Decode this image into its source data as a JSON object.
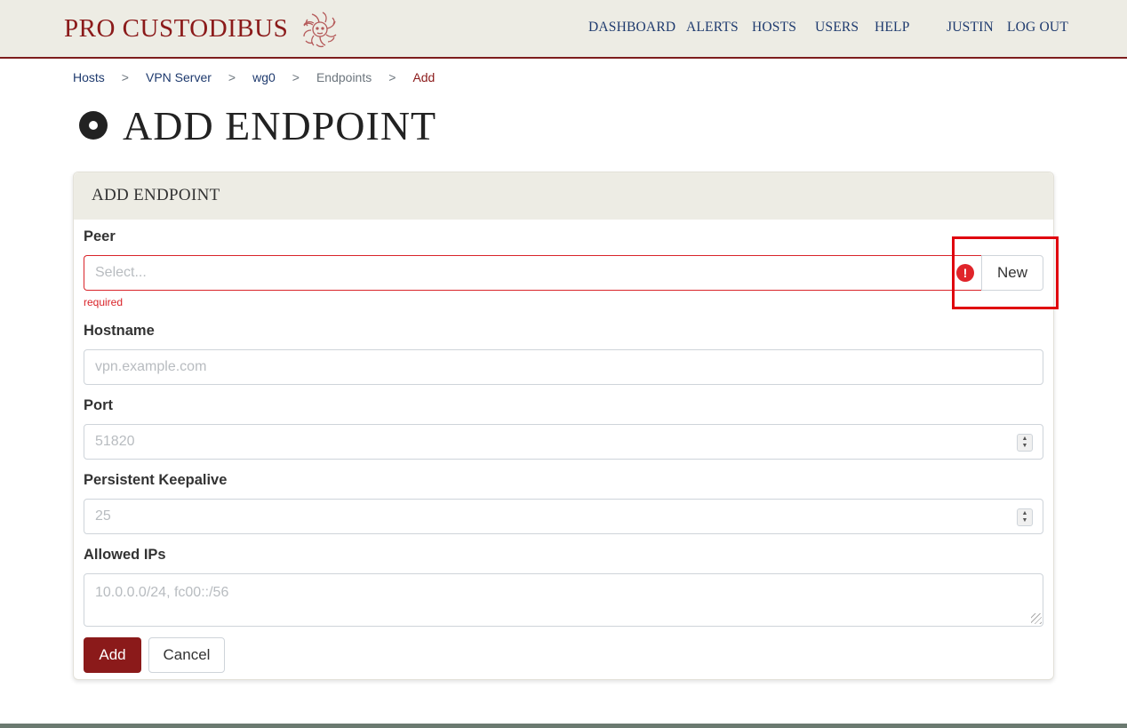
{
  "header": {
    "brand": "PRO CUSTODIBUS",
    "logo_icon": "medusa-logo-icon",
    "nav": [
      {
        "id": "dashboard",
        "label": "DASHBOARD"
      },
      {
        "id": "alerts",
        "label": "ALERTS"
      },
      {
        "id": "hosts",
        "label": "HOSTS"
      },
      {
        "id": "users",
        "label": "USERS"
      },
      {
        "id": "help",
        "label": "HELP"
      },
      {
        "id": "user",
        "label": "JUSTIN"
      },
      {
        "id": "logout",
        "label": "LOG OUT"
      }
    ]
  },
  "breadcrumb": [
    "Hosts",
    "VPN Server",
    "wg0",
    "Endpoints",
    "Add"
  ],
  "breadcrumb_separator": ">",
  "page_title": "ADD ENDPOINT",
  "card": {
    "title": "ADD ENDPOINT",
    "fields": {
      "peer": {
        "label": "Peer",
        "placeholder": "Select...",
        "value": "",
        "error": "required",
        "new_button": "New"
      },
      "hostname": {
        "label": "Hostname",
        "placeholder": "vpn.example.com",
        "value": ""
      },
      "port": {
        "label": "Port",
        "placeholder": "51820",
        "value": ""
      },
      "keepalive": {
        "label": "Persistent Keepalive",
        "placeholder": "25",
        "value": ""
      },
      "allowed_ips": {
        "label": "Allowed IPs",
        "placeholder": "10.0.0.0/24, fc00::/56",
        "value": ""
      }
    },
    "actions": {
      "add": "Add",
      "cancel": "Cancel"
    }
  },
  "colors": {
    "brand": "#8b1a1a",
    "nav": "#1e3a6e",
    "header_bg": "#edece4",
    "error": "#d9242a",
    "highlight": "#e0000e"
  }
}
